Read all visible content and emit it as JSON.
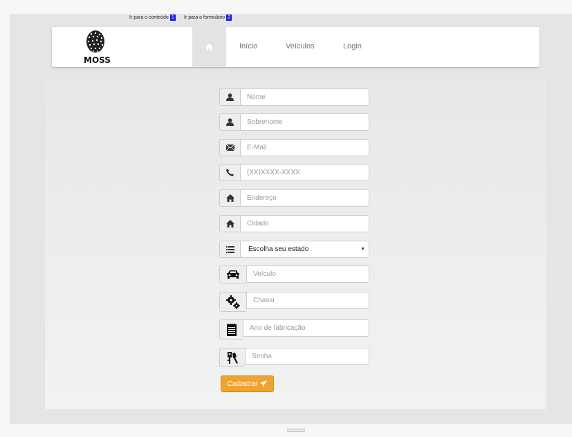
{
  "skip_links": {
    "content_label": "Ir para o conteúdo",
    "content_key": "1",
    "form_label": "Ir para o formulário",
    "form_key": "2"
  },
  "brand": {
    "name": "MOSS"
  },
  "nav": {
    "home_icon": "home-icon",
    "items": [
      {
        "label": "Início"
      },
      {
        "label": "Veículos"
      },
      {
        "label": "Login"
      }
    ]
  },
  "form": {
    "nome": {
      "placeholder": "Nome",
      "icon": "user-icon"
    },
    "sobrenome": {
      "placeholder": "Sobrenome",
      "icon": "user-icon"
    },
    "email": {
      "placeholder": "E-Mail",
      "icon": "envelope-icon"
    },
    "telefone": {
      "placeholder": "(XX)XXXX-XXXX",
      "icon": "phone-icon"
    },
    "endereco": {
      "placeholder": "Endereço",
      "icon": "home-icon"
    },
    "cidade": {
      "placeholder": "Cidade",
      "icon": "home-icon"
    },
    "estado": {
      "selected": "Escolha seu estado",
      "icon": "list-icon"
    },
    "veiculo": {
      "placeholder": "Veículo",
      "icon": "car-icon"
    },
    "chassi": {
      "placeholder": "Chassi",
      "icon": "gears-icon"
    },
    "ano": {
      "placeholder": "Ano de fabricação",
      "icon": "notepad-icon"
    },
    "senha": {
      "placeholder": "Senha",
      "icon": "keys-icon"
    },
    "submit_label": "Cadastrar"
  },
  "colors": {
    "accent": "#f0a430",
    "skip_badge": "#1a1ae6"
  }
}
